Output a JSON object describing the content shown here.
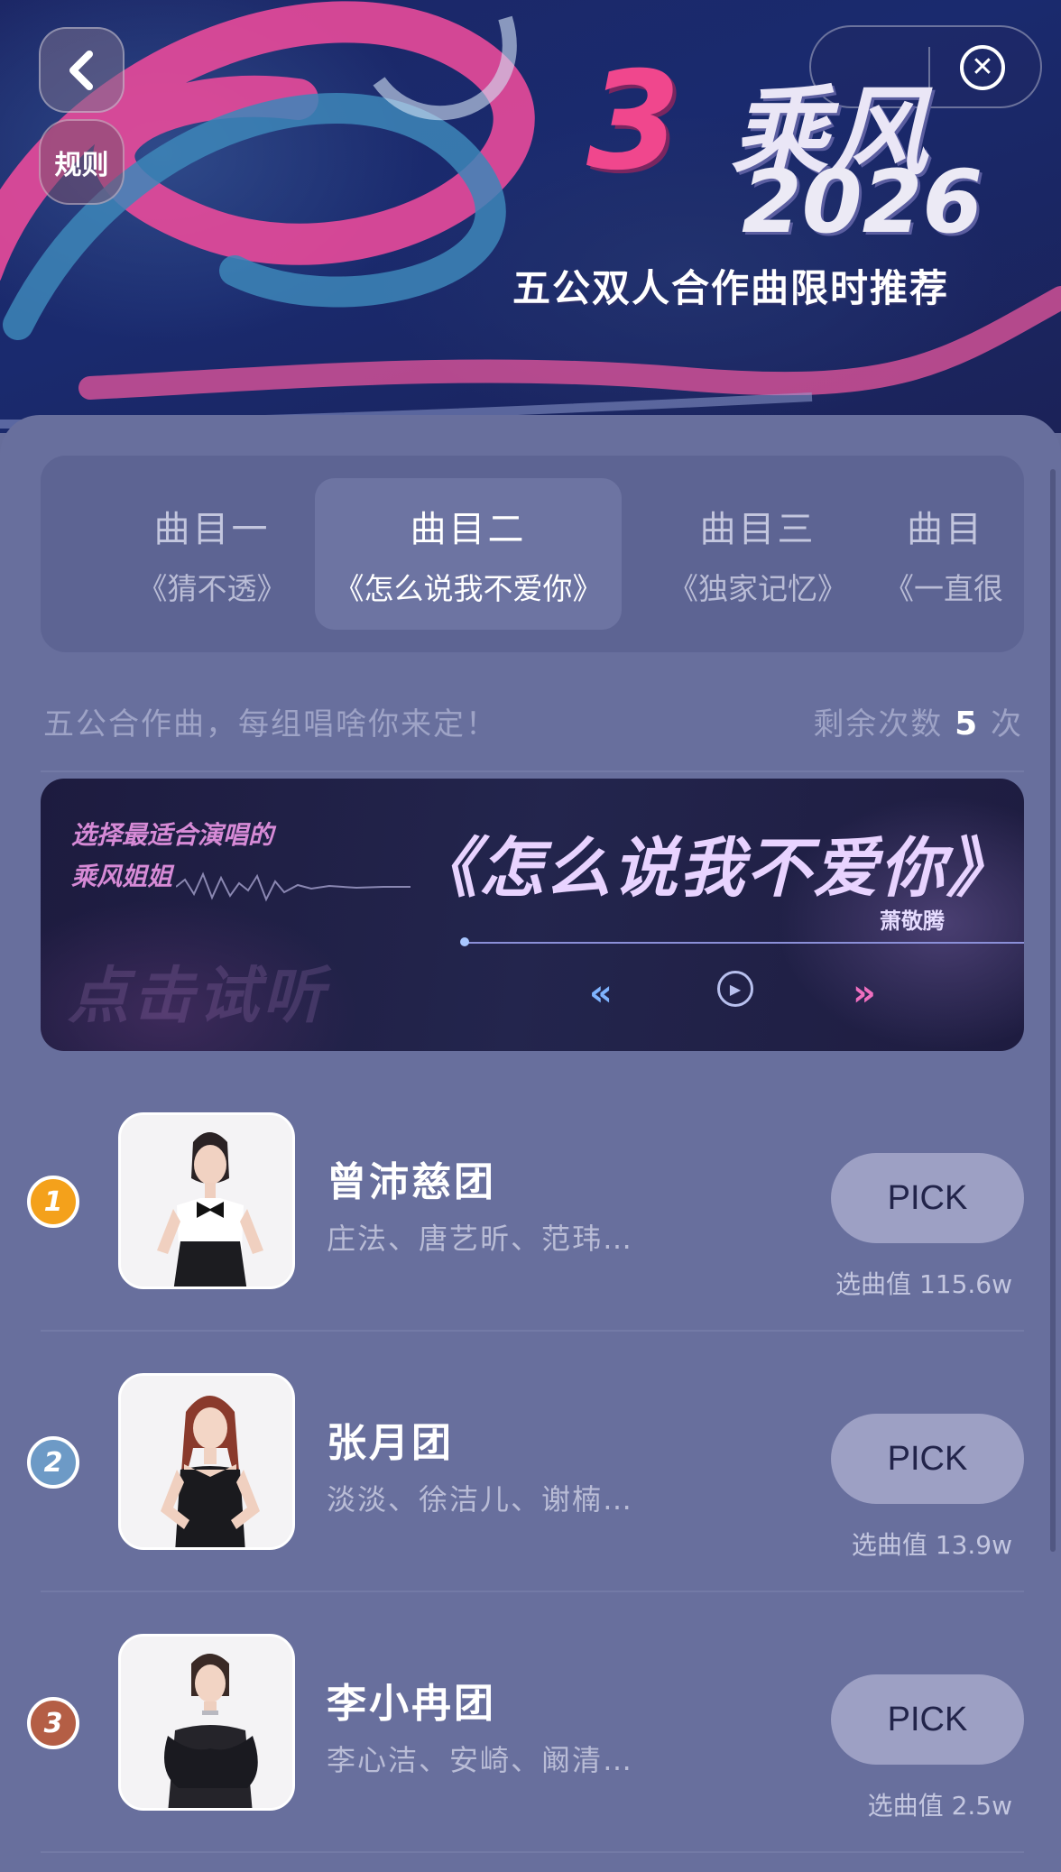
{
  "banner": {
    "back_icon": "chevron-left-icon",
    "rules_label": "规则",
    "close_icon": "close-icon",
    "logo_mark": "3",
    "title": "乘风",
    "year": "2026",
    "subtitle": "五公双人合作曲限时推荐"
  },
  "tabs": [
    {
      "label": "曲目一",
      "song": "《猜不透》",
      "active": false
    },
    {
      "label": "曲目二",
      "song": "《怎么说我不爱你》",
      "active": true
    },
    {
      "label": "曲目三",
      "song": "《独家记忆》",
      "active": false
    },
    {
      "label": "曲目",
      "song": "《一直很",
      "active": false
    }
  ],
  "hint": "五公合作曲，每组唱啥你来定！",
  "remaining": {
    "prefix": "剩余次数",
    "count": "5",
    "suffix": "次"
  },
  "song_card": {
    "prompt_line1": "选择最适合演唱的",
    "prompt_line2": "乘风姐姐",
    "title": "《怎么说我不爱你》",
    "artist": "萧敬腾",
    "listen_label": "点击试听",
    "prev_icon": "rewind-icon",
    "play_icon": "play-icon",
    "next_icon": "fast-forward-icon"
  },
  "rankings": [
    {
      "rank": "1",
      "group": "曾沛慈团",
      "members": "庄法、唐艺昕、范玮…",
      "button": "PICK",
      "score_label": "选曲值",
      "score": "115.6w"
    },
    {
      "rank": "2",
      "group": "张月团",
      "members": "淡淡、徐洁儿、谢楠…",
      "button": "PICK",
      "score_label": "选曲值",
      "score": "13.9w"
    },
    {
      "rank": "3",
      "group": "李小冉团",
      "members": "李心洁、安崎、阚清…",
      "button": "PICK",
      "score_label": "选曲值",
      "score": "2.5w"
    }
  ]
}
